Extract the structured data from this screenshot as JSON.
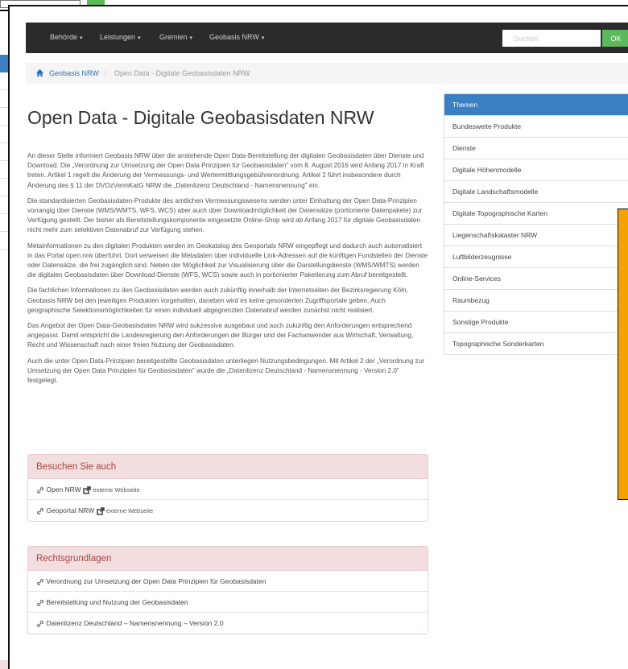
{
  "nav": {
    "items": [
      "Behörde",
      "Leistungen",
      "Gremien",
      "Geobasis NRW"
    ],
    "search_placeholder": "Suchen",
    "ok_label": "OK"
  },
  "breadcrumb": {
    "home": "Geobasis NRW",
    "separator": "/",
    "current": "Open Data - Digitale Geobasisdaten NRW"
  },
  "page_title": "Open Data - Digitale Geobasisdaten NRW",
  "paragraphs": [
    "An dieser Stelle informiert Geobasis NRW über die anstehende Open Data-Bereitstellung der digitalen Geobasisdaten über Dienste und Download. Die „Verordnung zur Umsetzung der Open Data Prinzipien für Geobasisdaten\" vom 8. August 2016 wird Anfang 2017 in Kraft treten. Artikel 1 regelt die Änderung der Vermessungs- und Wertermittlungsgebührenordnung. Artikel 2 führt insbesondere durch Änderung des § 11 der DVOzVermKatG NRW die „Datenlizenz Deutschland - Namensnennung\" ein.",
    "Die standardisierten Geobasisdaten-Produkte des amtlichen Vermessungswesens werden unter Einhaltung der Open Data-Prinzipien vorrangig über Dienste (WMS/WMTS, WFS, WCS) aber auch über Downloadmöglichkeit der Datensätze (portionierte Datenpakete) zur Verfügung gestellt. Der bisher als Bereitstellungskomponente eingesetzte Online-Shop wird ab Anfang 2017 für digitale Geobasisdaten nicht mehr zum selektiven Datenabruf zur Verfügung stehen.",
    "Metainformationen zu den digitalen Produkten werden im Geokatalog des Geoportals NRW eingepflegt und dadurch auch automatisiert in das Portal open.nrw überführt. Dort verweisen die Metadaten über individuelle Link-Adressen auf die künftigen Fundstellen der Dienste oder Datensätze, die frei zugänglich sind. Neben der Möglichkeit zur Visualisierung über die Darstellungdienste (WMS/WMTS) werden die digitalen Geobasisdaten über Download-Dienste (WFS, WCS) sowie auch in portionierter Paketierung zum Abruf bereitgestellt.",
    "Die fachlichen Informationen zu den Geobasisdaten werden auch zukünftig innerhalb der Internetseiten der Bezirksregierung Köln, Geobasis NRW bei den jeweiligen Produkten vorgehalten, daneben wird es keine gesonderten Zugriffsportale geben. Auch geographische Selektionsmöglichkeiten für einen individuell abgegrenzten Datenabruf werden zunächst nicht realisiert.",
    "Das Angebot der Open Data-Geobasisdaten NRW wird sukzessive ausgebaut und auch zukünftig den Anforderungen entsprechend angepasst. Damit entspricht die Landesregierung den Anforderungen der Bürger und der Fachanwender aus Wirtschaft, Verwaltung, Recht und Wissenschaft nach einer freien Nutzung der Geobasisdaten.",
    "Auch die unter Open Data-Prinzipien bereitgestellte Geobasisdaten unterliegen Nutzungsbedingungen. Mit Artikel 2 der „Verordnung zur Umsetzung der Open Data Prinzipien für Geobasisdaten\" wurde die „Datenlizenz Deutschland - Namensnennung - Version 2.0\" festgelegt."
  ],
  "panel_visit": {
    "title": "Besuchen Sie auch",
    "links": [
      {
        "label": "Open NRW",
        "ext": "externe Webseite"
      },
      {
        "label": "Geoportal NRW",
        "ext": "externe Webseite"
      }
    ]
  },
  "panel_legal": {
    "title": "Rechtsgrundlagen",
    "links": [
      "Verordnung zur Umsetzung der Open Data Prinzipien für Geobasisdaten",
      "Bereitstellung und Nutzung der Geobasisdaten",
      "Datenlizenz Deutschland – Namensnennung – Version 2.0"
    ]
  },
  "sidebar": {
    "title": "Themen",
    "items": [
      "Bundesweite Produkte",
      "Dienste",
      "Digitale Höhenmodelle",
      "Digitale Landschaftsmodelle",
      "Digitale Topographische Karten",
      "Liegenschaftskataster NRW",
      "Luftbilderzeugnisse",
      "Online-Services",
      "Raumbezug",
      "Sonstige Produkte",
      "Topographische Sonderkarten"
    ]
  },
  "colors": {
    "navbar": "#2b2b2b",
    "ok_button": "#5cb85c",
    "sidebar_head": "#3a80c2",
    "panel_head": "#f2dede",
    "panel_title": "#a94442",
    "orange": "#f5a200"
  }
}
